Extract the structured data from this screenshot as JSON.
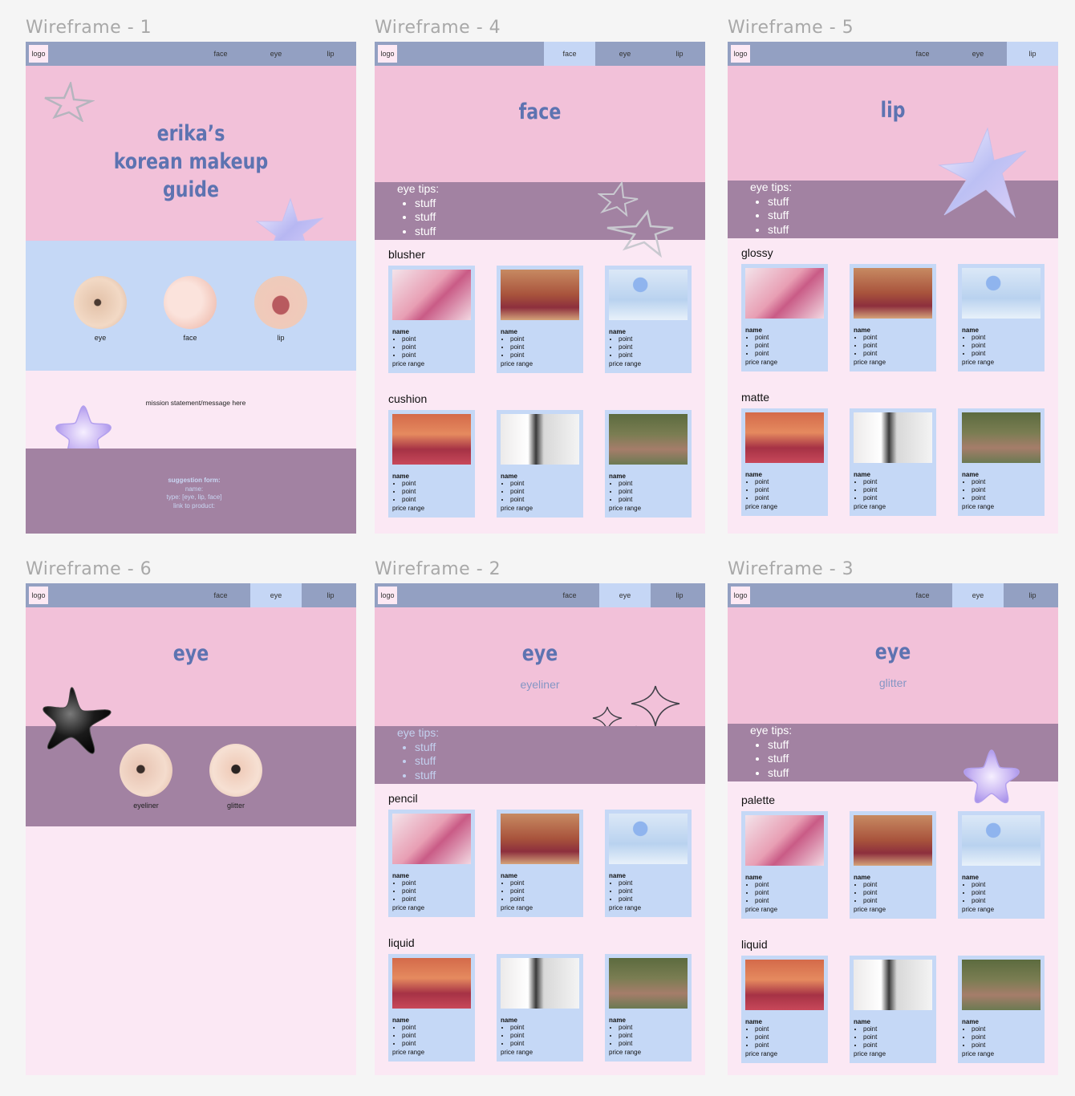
{
  "frames": {
    "f1": {
      "title": "Wireframe - 1",
      "nav": {
        "logo": "logo",
        "face": "face",
        "eye": "eye",
        "lip": "lip"
      },
      "hero": [
        "erika’s",
        "korean makeup",
        "guide"
      ],
      "categories": {
        "eye": "eye",
        "face": "face",
        "lip": "lip"
      },
      "mission": "mission statement/message here",
      "form": {
        "title": "suggestion form:",
        "name": "name:",
        "type": "type: [eye, lip, face]",
        "link": "link to product:"
      }
    },
    "f4": {
      "title": "Wireframe - 4",
      "nav": {
        "logo": "logo",
        "face": "face",
        "eye": "eye",
        "lip": "lip"
      },
      "heading": "face",
      "tips": {
        "label": "eye tips:",
        "items": [
          "stuff",
          "stuff",
          "stuff"
        ]
      },
      "sections": [
        "blusher",
        "cushion"
      ]
    },
    "f5": {
      "title": "Wireframe - 5",
      "nav": {
        "logo": "logo",
        "face": "face",
        "eye": "eye",
        "lip": "lip"
      },
      "heading": "lip",
      "tips": {
        "label": "eye tips:",
        "items": [
          "stuff",
          "stuff",
          "stuff"
        ]
      },
      "sections": [
        "glossy",
        "matte"
      ]
    },
    "f6": {
      "title": "Wireframe - 6",
      "nav": {
        "logo": "logo",
        "face": "face",
        "eye": "eye",
        "lip": "lip"
      },
      "heading": "eye",
      "categories": {
        "eyeliner": "eyeliner",
        "glitter": "glitter"
      }
    },
    "f2": {
      "title": "Wireframe - 2",
      "nav": {
        "logo": "logo",
        "face": "face",
        "eye": "eye",
        "lip": "lip"
      },
      "heading": "eye",
      "subheading": "eyeliner",
      "tips": {
        "label": "eye tips:",
        "items": [
          "stuff",
          "stuff",
          "stuff"
        ]
      },
      "sections": [
        "pencil",
        "liquid"
      ]
    },
    "f3": {
      "title": "Wireframe - 3",
      "nav": {
        "logo": "logo",
        "face": "face",
        "eye": "eye",
        "lip": "lip"
      },
      "heading": "eye",
      "subheading": "glitter",
      "tips": {
        "label": "eye tips:",
        "items": [
          "stuff",
          "stuff",
          "stuff"
        ]
      },
      "sections": [
        "palette",
        "liquid"
      ]
    }
  },
  "card": {
    "name": "name",
    "points": [
      "point",
      "point",
      "point"
    ],
    "price": "price range"
  },
  "colors": {
    "nav": "#93a0c2",
    "nav_active": "#c5d6f5",
    "pink": "#f2c1d9",
    "blue": "#c5d8f6",
    "purple": "#a282a2",
    "light": "#fbe8f4",
    "heading": "#5d73b1"
  }
}
